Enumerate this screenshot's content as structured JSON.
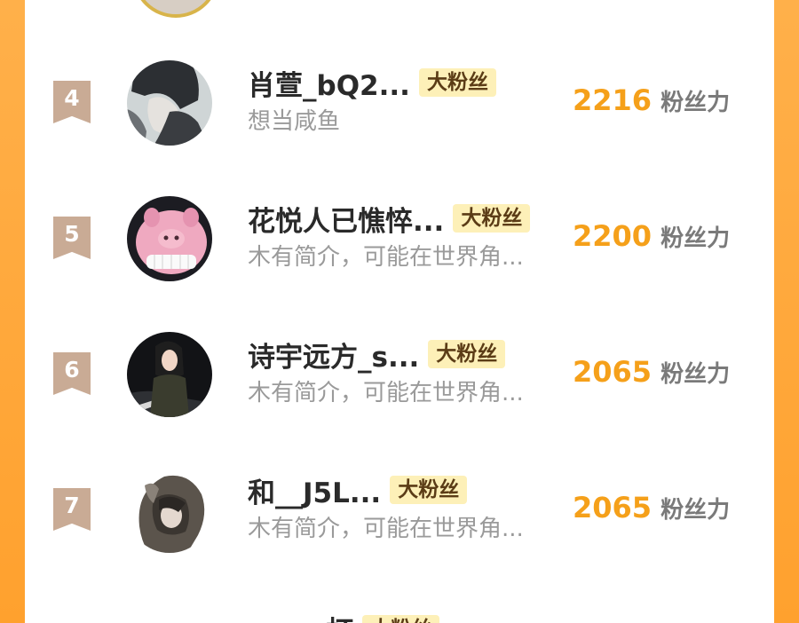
{
  "list_item_label": "粉丝力",
  "badge_label": "大粉丝",
  "rows": [
    {
      "rank": "4",
      "name": "肖萱_bQ2...",
      "bio": "想当咸鱼",
      "score": "2216"
    },
    {
      "rank": "5",
      "name": "花悦人已憔悴...",
      "bio": "木有简介，可能在世界角...",
      "score": "2200"
    },
    {
      "rank": "6",
      "name": "诗宇远方_s...",
      "bio": "木有简介，可能在世界角...",
      "score": "2065"
    },
    {
      "rank": "7",
      "name": "和__J5L...",
      "bio": "木有简介，可能在世界角...",
      "score": "2065"
    }
  ],
  "partial_next_row": {
    "name": "error杯"
  },
  "colors": {
    "side_orange": "#ffa12e",
    "rank_badge": "#c9ab95",
    "score": "#f5a01a",
    "tag_bg": "#fdf0b8"
  }
}
